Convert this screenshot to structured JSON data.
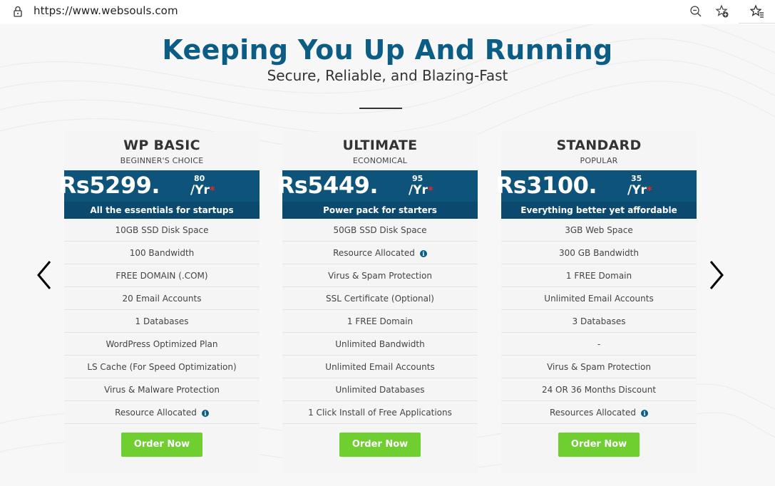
{
  "browser": {
    "url": "https://www.websouls.com"
  },
  "hero": {
    "title": "Keeping You Up And Running",
    "subtitle": "Secure, Reliable, and Blazing-Fast"
  },
  "colors": {
    "brand_blue": "#0c5d86",
    "price_bg": "#0e5379",
    "tagline_bg": "#0b4a6e",
    "order_green": "#6fce30",
    "star_red": "#e02a2a"
  },
  "plans": [
    {
      "name": "WP BASIC",
      "tag": "BEGINNER'S CHOICE",
      "price": "Rs5299.",
      "cents": "80",
      "period": "/Yr",
      "star": "*",
      "tagline": "All the essentials for startups",
      "features": [
        {
          "text": "10GB SSD Disk Space",
          "info": false
        },
        {
          "text": "100 Bandwidth",
          "info": false
        },
        {
          "text": "FREE DOMAIN (.COM)",
          "info": false
        },
        {
          "text": "20 Email Accounts",
          "info": false
        },
        {
          "text": "1 Databases",
          "info": false
        },
        {
          "text": "WordPress Optimized Plan",
          "info": false
        },
        {
          "text": "LS Cache (For Speed Optimization)",
          "info": false
        },
        {
          "text": "Virus & Malware Protection",
          "info": false
        },
        {
          "text": "Resource Allocated",
          "info": true
        }
      ],
      "order_label": "Order Now"
    },
    {
      "name": "ULTIMATE",
      "tag": "ECONOMICAL",
      "price": "Rs5449.",
      "cents": "95",
      "period": "/Yr",
      "star": "*",
      "tagline": "Power pack for starters",
      "features": [
        {
          "text": "50GB SSD Disk Space",
          "info": false
        },
        {
          "text": "Resource Allocated",
          "info": true
        },
        {
          "text": "Virus & Spam Protection",
          "info": false
        },
        {
          "text": "SSL Certificate (Optional)",
          "info": false
        },
        {
          "text": "1 FREE Domain",
          "info": false
        },
        {
          "text": "Unlimited Bandwidth",
          "info": false
        },
        {
          "text": "Unlimited Email Accounts",
          "info": false
        },
        {
          "text": "Unlimited Databases",
          "info": false
        },
        {
          "text": "1 Click Install of Free Applications",
          "info": false
        }
      ],
      "order_label": "Order Now"
    },
    {
      "name": "STANDARD",
      "tag": "POPULAR",
      "price": "Rs3100.",
      "cents": "35",
      "period": "/Yr",
      "star": "*",
      "tagline": "Everything better yet affordable",
      "features": [
        {
          "text": "3GB Web Space",
          "info": false
        },
        {
          "text": "300 GB Bandwidth",
          "info": false
        },
        {
          "text": "1 FREE Domain",
          "info": false
        },
        {
          "text": "Unlimited Email Accounts",
          "info": false
        },
        {
          "text": "3 Databases",
          "info": false
        },
        {
          "text": "-",
          "info": false
        },
        {
          "text": "Virus & Spam Protection",
          "info": false
        },
        {
          "text": "24 OR 36 Months Discount",
          "info": false
        },
        {
          "text": "Resources Allocated",
          "info": true
        }
      ],
      "order_label": "Order Now"
    }
  ],
  "icons": {
    "lock": "lock-icon",
    "zoom": "zoom-out-icon",
    "favorite_add": "star-add-icon",
    "favorites": "favorites-list-icon",
    "prev": "chevron-left-icon",
    "next": "chevron-right-icon",
    "info": "info-icon",
    "info_glyph": "i"
  }
}
